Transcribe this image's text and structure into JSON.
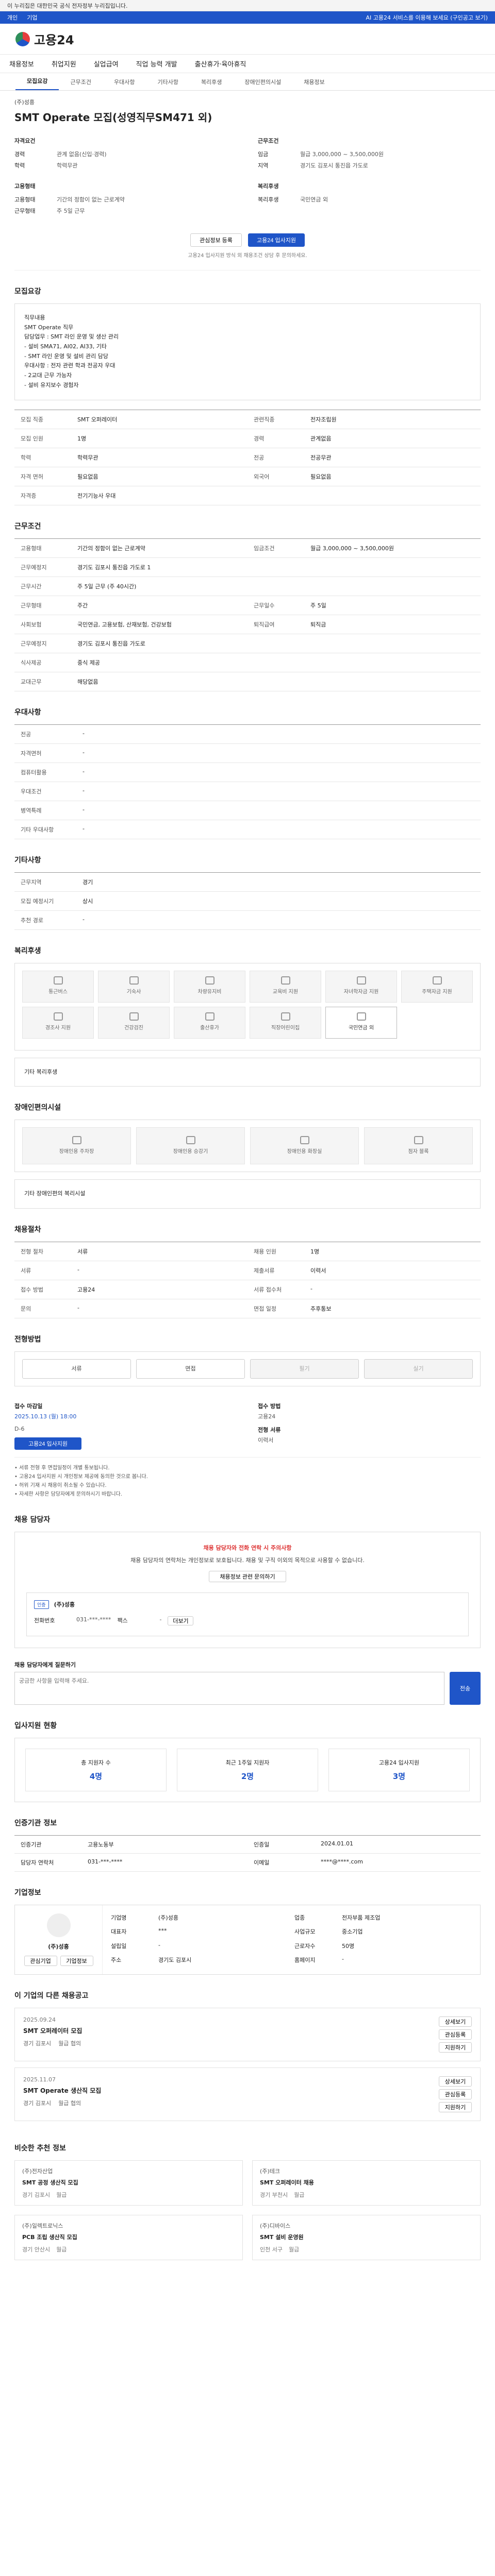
{
  "topbar": {
    "notice": "이 누리집은 대한민국 공식 전자정부 누리집입니다."
  },
  "bluebar": {
    "links": [
      "개인",
      "기업"
    ],
    "right": "AI 고용24 서비스를 이용해 보세요 (구인공고 보기)"
  },
  "logo": {
    "text": "고용24"
  },
  "gnb": [
    "채용정보",
    "취업지원",
    "실업급여",
    "직업 능력 개발",
    "출산휴가·육아휴직"
  ],
  "tabs": [
    "모집요강",
    "근무조건",
    "우대사항",
    "기타사항",
    "복리후생",
    "장애인편의시설",
    "채용정보"
  ],
  "job": {
    "company": "(주)성흥",
    "title": "SMT Operate 모집(성영직무SM471 외)",
    "group_left": "자격요건",
    "group_right": "근무조건",
    "kv_left": [
      [
        "경력",
        "관계 없음(신입·경력)"
      ],
      [
        "학력",
        "학력무관"
      ]
    ],
    "kv_right": [
      [
        "임금",
        "월급 3,000,000 ~ 3,500,000원"
      ],
      [
        "지역",
        "경기도 김포시 통진읍 가도로"
      ]
    ],
    "group_left2": "고용형태",
    "group_right2": "복리후생",
    "kv_left2": [
      [
        "고용형태",
        "기간의 정함이 없는 근로계약"
      ],
      [
        "근무형태",
        "주 5일 근무"
      ]
    ],
    "kv_right2": [
      [
        "복리후생",
        "국민연금 외"
      ]
    ]
  },
  "actions": {
    "save": "관심정보 등록",
    "apply": "고용24 입사지원"
  },
  "note_small": "고용24 입사지원 방식 외 채용조건 상담 후 문의하세요.",
  "sections": {
    "recruit": "모집요강",
    "work": "근무조건",
    "prefer": "우대사항",
    "etc": "기타사항",
    "welfare": "복리후생",
    "facility": "장애인편의시설",
    "process": "채용절차",
    "apply_method": "전형방법",
    "inquiry": "채용 담당자",
    "stats": "입사지원 현황",
    "manager": "인증기관 정보",
    "company": "기업정보",
    "similar": "이 기업의 다른 채용공고",
    "recommend": "비슷한 추천 정보"
  },
  "recruit_box": [
    "직무내용",
    "SMT Operate 직무",
    "담당업무 : SMT 라인 운영 및 생산 관리",
    "- 설비 SMA71, AI02, AI33, 기타",
    "- SMT 라인 운영 및 설비 관리 담당",
    "우대사항 : 전자 관련 학과 전공자 우대",
    "- 2교대 근무 가능자",
    "- 설비 유지보수 경험자"
  ],
  "recruit_tbl": [
    [
      "모집 직종",
      "SMT 오퍼레이터",
      "관련직종",
      "전자조립원"
    ],
    [
      "모집 인원",
      "1명",
      "경력",
      "관계없음"
    ],
    [
      "학력",
      "학력무관",
      "전공",
      "전공무관"
    ],
    [
      "자격 면허",
      "필요없음",
      "외국어",
      "필요없음"
    ],
    [
      "자격증",
      "전기기능사 우대"
    ]
  ],
  "work_tbl": [
    [
      "고용형태",
      "기간의 정함이 없는 근로계약",
      "임금조건",
      "월급 3,000,000 ~ 3,500,000원"
    ],
    [
      "근무예정지",
      "경기도 김포시 통진읍 가도로 1"
    ],
    [
      "근무시간",
      "주 5일 근무 (주 40시간)"
    ],
    [
      "근무형태",
      "주간",
      "근무일수",
      "주 5일"
    ],
    [
      "사회보험",
      "국민연금, 고용보험, 산재보험, 건강보험",
      "퇴직급여",
      "퇴직금"
    ],
    [
      "근무예정지",
      "경기도 김포시 통진읍 가도로"
    ],
    [
      "식사제공",
      "중식 제공"
    ],
    [
      "교대근무",
      "해당없음"
    ]
  ],
  "prefer_tbl": [
    [
      "전공",
      "-"
    ],
    [
      "자격면허",
      "-"
    ],
    [
      "컴퓨터활용",
      "-"
    ],
    [
      "우대조건",
      "-"
    ],
    [
      "병역특례",
      "-"
    ],
    [
      "기타 우대사항",
      "-"
    ]
  ],
  "etc_tbl": [
    [
      "근무지역",
      "경기"
    ],
    [
      "모집 예정시기",
      "상시"
    ],
    [
      "추천 경로",
      "-"
    ]
  ],
  "welfare_icons": [
    "통근버스",
    "기숙사",
    "차량유지비",
    "교육비 지원",
    "자녀학자금 지원",
    "주택자금 지원",
    "경조사 지원",
    "건강검진",
    "출산휴가",
    "직장어린이집",
    "국민연금 외"
  ],
  "welfare_active_index": 10,
  "welfare_other": "기타 복리후생",
  "facility_icons": [
    "장애인용 주차장",
    "장애인용 승강기",
    "장애인용 화장실",
    "점자 블록"
  ],
  "facility_other": "기타 장애인편의 복리시설",
  "process_tbl": [
    [
      "전형 절차",
      "서류",
      "채용 인원",
      "1명"
    ],
    [
      "서류",
      "-",
      "제출서류",
      "이력서"
    ],
    [
      "접수 방법",
      "고용24",
      "서류 접수처",
      "-"
    ],
    [
      "문의",
      "-",
      "면접 일정",
      "추후통보"
    ]
  ],
  "method_pills": [
    "서류",
    "면접",
    "필기",
    "실기"
  ],
  "apply": {
    "left_label": "접수 마감일",
    "left_value": "2025.10.13 (월) 18:00",
    "left_sub": "D-6",
    "right_label": "접수 방법",
    "right_value": "고용24",
    "right_label2": "전형 서류",
    "right_value2": "이력서"
  },
  "bullets": [
    "• 서류 전형 후 면접일정이 개별 통보됩니다.",
    "• 고용24 입사지원 시 개인정보 제공에 동의한 것으로 봅니다.",
    "• 허위 기재 시 채용이 취소될 수 있습니다.",
    "• 자세한 사항은 담당자에게 문의하시기 바랍니다."
  ],
  "warn": {
    "head": "채용 담당자와 전화 연락 시 주의사항",
    "text": "채용 담당자의 연락처는 개인정보로 보호됩니다. 채용 및 구직 이외의 목적으로 사용할 수 없습니다.",
    "link": "채용정보 관련 문의하기",
    "company": "(주)성흥",
    "badge": "인증",
    "contact_label": "전화번호",
    "contact_value": "031-***-****",
    "fax_label": "팩스",
    "fax_value": "-",
    "more": "더보기"
  },
  "inquiry": {
    "label": "채용 담당자에게 질문하기",
    "placeholder": "궁금한 사항을 입력해 주세요.",
    "send": "전송"
  },
  "stats": [
    [
      "총 지원자 수",
      "4명"
    ],
    [
      "최근 1주일 지원자",
      "2명"
    ],
    [
      "고용24 입사지원",
      "3명"
    ]
  ],
  "manager_tbl": [
    [
      "인증기관",
      "고용노동부",
      "인증일",
      "2024.01.01"
    ],
    [
      "담당자 연락처",
      "031-***-****",
      "이메일",
      "****@****.com"
    ]
  ],
  "company": {
    "name": "(주)성흥",
    "btn1": "관심기업",
    "btn2": "기업정보",
    "rows": [
      [
        "기업명",
        "(주)성흥",
        "업종",
        "전자부품 제조업"
      ],
      [
        "대표자",
        "***",
        "사업규모",
        "중소기업"
      ],
      [
        "설립일",
        "-",
        "근로자수",
        "50명"
      ],
      [
        "주소",
        "경기도 김포시",
        "홈페이지",
        "-"
      ]
    ]
  },
  "similar": [
    {
      "date": "2025.09.24",
      "title": "SMT 오퍼레이터 모집",
      "loc": "경기 김포시",
      "pay": "월급 협의",
      "btns": [
        "상세보기",
        "관심등록",
        "지원하기"
      ]
    },
    {
      "date": "2025.11.07",
      "title": "SMT Operate 생산직 모집",
      "loc": "경기 김포시",
      "pay": "월급 협의",
      "btns": [
        "상세보기",
        "관심등록",
        "지원하기"
      ]
    }
  ],
  "recommend": [
    {
      "company": "(주)전자산업",
      "title": "SMT 공정 생산직 모집",
      "loc": "경기 김포시",
      "pay": "월급"
    },
    {
      "company": "(주)테크",
      "title": "SMT 오퍼레이터 채용",
      "loc": "경기 부천시",
      "pay": "월급"
    },
    {
      "company": "(주)일렉트로닉스",
      "title": "PCB 조립 생산직 모집",
      "loc": "경기 안산시",
      "pay": "월급"
    },
    {
      "company": "(주)디바이스",
      "title": "SMT 설비 운영원",
      "loc": "인천 서구",
      "pay": "월급"
    }
  ]
}
